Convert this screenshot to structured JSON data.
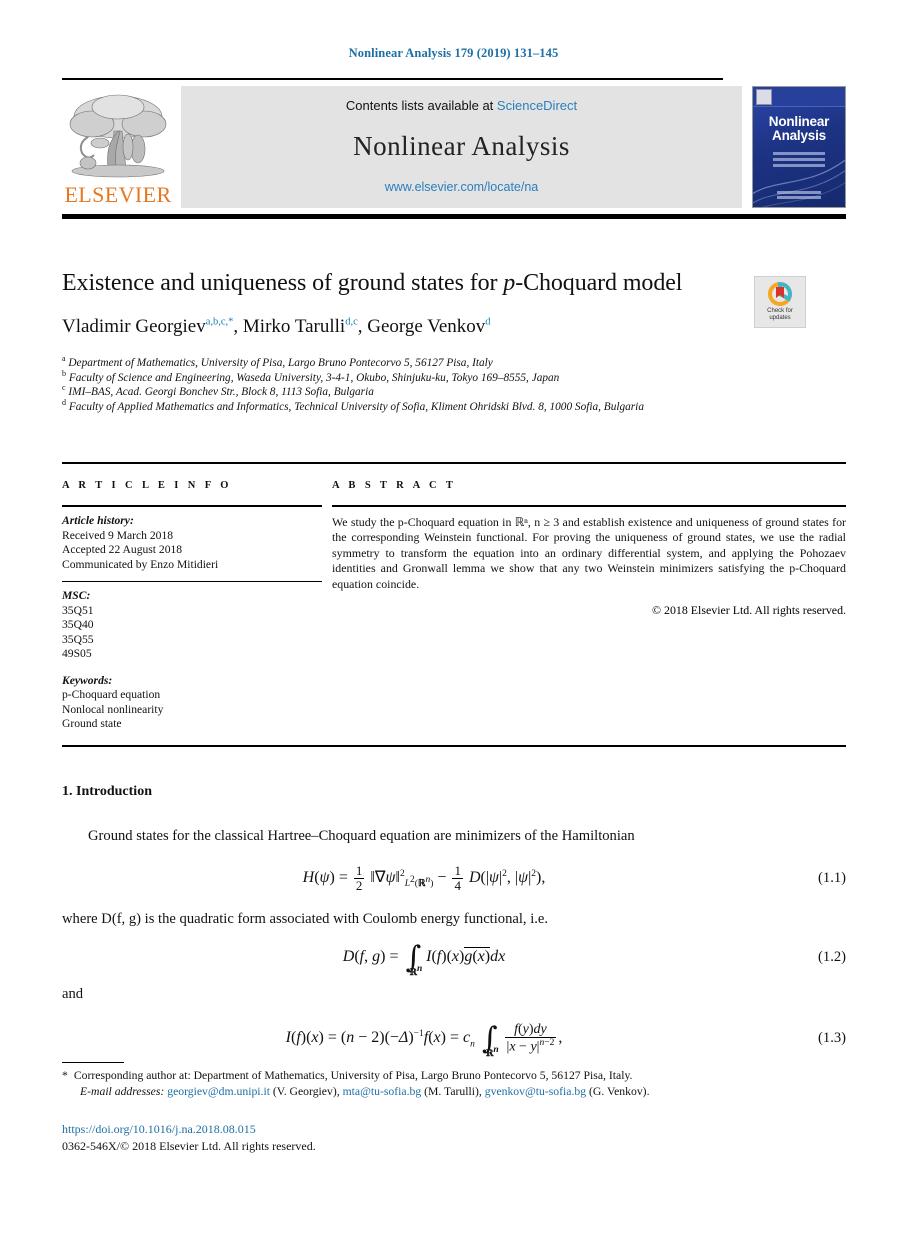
{
  "running_head": "Nonlinear Analysis 179 (2019) 131–145",
  "header": {
    "contents_prefix": "Contents lists available at",
    "sciencedirect_link": "ScienceDirect",
    "journal_name": "Nonlinear Analysis",
    "journal_url": "www.elsevier.com/locate/na",
    "publisher_wordmark": "ELSEVIER",
    "cover_title_line1": "Nonlinear",
    "cover_title_line2": "Analysis"
  },
  "title": {
    "text_before_italic": "Existence and uniqueness of ground states for ",
    "italic_part": "p",
    "text_after_italic": "-Choquard model"
  },
  "crossmark": {
    "line1": "Check for",
    "line2": "updates"
  },
  "authors": [
    {
      "name": "Vladimir Georgiev",
      "marks": "a,b,c,*"
    },
    {
      "name": "Mirko Tarulli",
      "marks": "d,c"
    },
    {
      "name": "George Venkov",
      "marks": "d"
    }
  ],
  "affiliations": [
    {
      "mark": "a",
      "text": "Department of Mathematics, University of Pisa, Largo Bruno Pontecorvo 5, 56127 Pisa, Italy"
    },
    {
      "mark": "b",
      "text": "Faculty of Science and Engineering, Waseda University, 3-4-1, Okubo, Shinjuku-ku, Tokyo 169–8555, Japan"
    },
    {
      "mark": "c",
      "text": "IMI–BAS, Acad. Georgi Bonchev Str., Block 8, 1113 Sofia, Bulgaria"
    },
    {
      "mark": "d",
      "text": "Faculty of Applied Mathematics and Informatics, Technical University of Sofia, Kliment Ohridski Blvd. 8, 1000 Sofia, Bulgaria"
    }
  ],
  "article_info": {
    "label": "A R T I C L E   I N F O",
    "history_head": "Article history:",
    "history": [
      "Received 9 March 2018",
      "Accepted 22 August 2018",
      "Communicated by Enzo Mitidieri"
    ],
    "msc_head": "MSC:",
    "msc": [
      "35Q51",
      "35Q40",
      "35Q55",
      "49S05"
    ],
    "keywords_head": "Keywords:",
    "keywords": [
      "p-Choquard equation",
      "Nonlocal nonlinearity",
      "Ground state"
    ]
  },
  "abstract": {
    "label": "A B S T R A C T",
    "text": "We study the p-Choquard equation in ℝⁿ, n ≥ 3 and establish existence and uniqueness of ground states for the corresponding Weinstein functional. For proving the uniqueness of ground states, we use the radial symmetry to transform the equation into an ordinary differential system, and applying the Pohozaev identities and Gronwall lemma we show that any two Weinstein minimizers satisfying the p-Choquard equation coincide.",
    "copyright": "© 2018 Elsevier Ltd. All rights reserved."
  },
  "body": {
    "section_heading": "1. Introduction",
    "para1": "Ground states for the classical Hartree–Choquard equation are minimizers of the Hamiltonian",
    "para2": "where D(f, g) is the quadratic form associated with Coulomb energy functional, i.e.",
    "para3": "and",
    "equations": [
      {
        "number": "(1.1)",
        "latexish": "H(ψ) = 1/2 ‖∇ψ‖²_{L²(ℝⁿ)} − 1/4 D(|ψ|², |ψ|²),"
      },
      {
        "number": "(1.2)",
        "latexish": "D(f, g) = ∫_{ℝⁿ} I(f)(x) conj(g(x)) dx"
      },
      {
        "number": "(1.3)",
        "latexish": "I(f)(x) = (n − 2)(−Δ)^{−1} f(x) = c_n ∫_{ℝⁿ} f(y)dy / |x − y|^{n−2},"
      }
    ]
  },
  "footnotes": {
    "star_mark": "*",
    "corresponding": "Corresponding author at: Department of Mathematics, University of Pisa, Largo Bruno Pontecorvo 5, 56127 Pisa, Italy.",
    "email_label": "E-mail addresses:",
    "emails": [
      {
        "address": "georgiev@dm.unipi.it",
        "person": "(V. Georgiev)"
      },
      {
        "address": "mta@tu-sofia.bg",
        "person": "(M. Tarulli)"
      },
      {
        "address": "gvenkov@tu-sofia.bg",
        "person": "(G. Venkov)."
      }
    ],
    "doi": "https://doi.org/10.1016/j.na.2018.08.015",
    "issn_line": "0362-546X/© 2018 Elsevier Ltd. All rights reserved."
  },
  "colors": {
    "link_blue": "#1d6fa5",
    "sciencedirect_blue": "#2a7fbd",
    "elsevier_orange": "#e87722",
    "cover_blue": "#1d3384"
  }
}
